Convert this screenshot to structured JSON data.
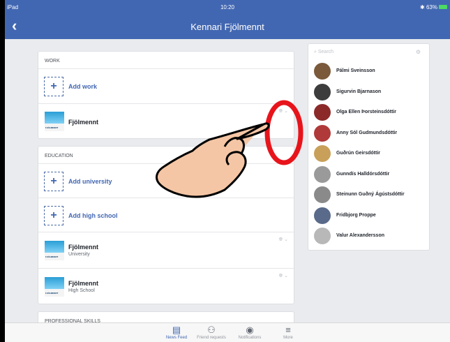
{
  "status": {
    "carrier": "iPad",
    "time": "10:20",
    "battery": "63%",
    "bluetooth": "✱"
  },
  "nav": {
    "back": "‹",
    "title": "Kennari Fjölmennt"
  },
  "work": {
    "heading": "WORK",
    "add_label": "Add work",
    "entries": [
      {
        "name": "Fjölmennt",
        "sub": ""
      }
    ]
  },
  "education": {
    "heading": "EDUCATION",
    "add_university": "Add university",
    "add_high_school": "Add high school",
    "entries": [
      {
        "name": "Fjölmennt",
        "sub": "University"
      },
      {
        "name": "Fjölmennt",
        "sub": "High School"
      }
    ]
  },
  "skills": {
    "heading": "PROFESSIONAL SKILLS"
  },
  "logo_text": "FJÖLMENNT",
  "plus": "+",
  "search": {
    "placeholder": "Search",
    "icon": "⌕",
    "settings_icon": "⚙"
  },
  "friends": [
    {
      "name": "Pálmi Sveinsson",
      "color": "#7a5a3a"
    },
    {
      "name": "Sigurvin Bjarnason",
      "color": "#3d3d3d"
    },
    {
      "name": "Olga Ellen Þorsteinsdóttir",
      "color": "#8c2a2a"
    },
    {
      "name": "Anny Sól Gudmundsdóttir",
      "color": "#b03a3a"
    },
    {
      "name": "Guðrún Geirsdóttir",
      "color": "#c8a05a"
    },
    {
      "name": "Gunndís Halldórsdóttir",
      "color": "#9a9a9a"
    },
    {
      "name": "Steinunn Guðný Ágústsdóttir",
      "color": "#8a8a8a"
    },
    {
      "name": "Fridbjorg Proppe",
      "color": "#5a6a8a"
    },
    {
      "name": "Valur Alexandersson",
      "color": "#b8b8b8"
    }
  ],
  "tabs": [
    {
      "label": "News Feed",
      "icon": "▤"
    },
    {
      "label": "Friend requests",
      "icon": "⚇"
    },
    {
      "label": "Notifications",
      "icon": "◉"
    },
    {
      "label": "More",
      "icon": "≡"
    }
  ],
  "icons": {
    "privacy": "🌐︎",
    "chevron": "⌄"
  },
  "colors": {
    "brand": "#4267b2",
    "annotation_circle": "#e8141b",
    "hand": "#f5c6a5"
  }
}
